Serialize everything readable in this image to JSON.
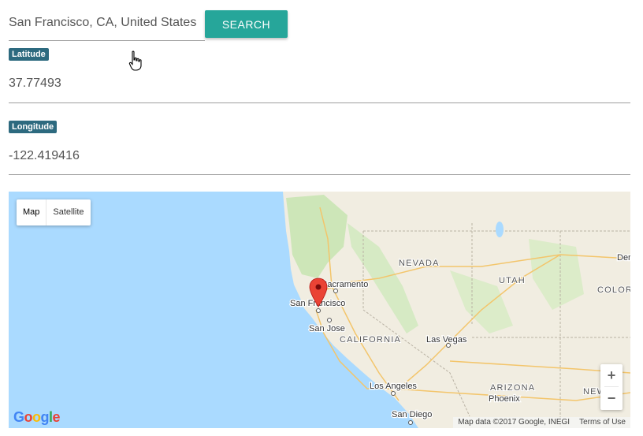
{
  "search": {
    "value": "San Francisco, CA, United States",
    "button_label": "SEARCH"
  },
  "latitude": {
    "label": "Latitude",
    "value": "37.77493"
  },
  "longitude": {
    "label": "Longitude",
    "value": "-122.419416"
  },
  "map": {
    "type_control": {
      "map_label": "Map",
      "satellite_label": "Satellite",
      "selected": "Map"
    },
    "zoom_in_label": "+",
    "zoom_out_label": "−",
    "state_labels": {
      "nevada": "NEVADA",
      "utah": "UTAH",
      "california": "CALIFORNIA",
      "arizona": "ARIZONA",
      "colorado": "COLORA",
      "new_mexico": "NEW M"
    },
    "city_labels": {
      "sacramento": "Sacramento",
      "san_francisco": "San Francisco",
      "san_jose": "San Jose",
      "las_vegas": "Las Vegas",
      "los_angeles": "Los Angeles",
      "san_diego": "San Diego",
      "phoenix": "Phoenix",
      "denver": "Der"
    },
    "logo_letters": [
      "G",
      "o",
      "o",
      "g",
      "l",
      "e"
    ],
    "logo_colors": [
      "#4285F4",
      "#EA4335",
      "#FBBC05",
      "#4285F4",
      "#34A853",
      "#EA4335"
    ],
    "attribution": "Map data ©2017 Google, INEGI",
    "terms": "Terms of Use",
    "marker_color": "#ea4335",
    "water_color": "#aadaff",
    "land_color": "#f1ede1"
  }
}
